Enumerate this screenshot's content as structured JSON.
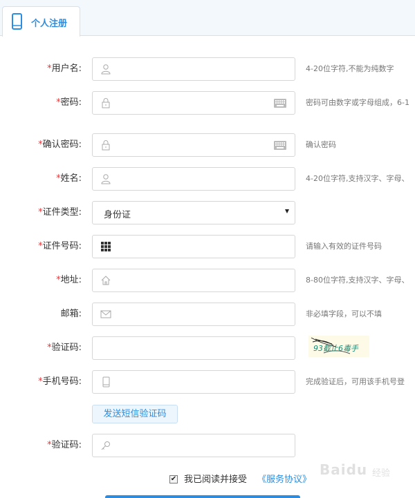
{
  "tab": {
    "label": "个人注册"
  },
  "required_mark": "*",
  "fields": {
    "username": {
      "label": "用户名:",
      "hint": "4-20位字符,不能为纯数字",
      "value": ""
    },
    "password": {
      "label": "密码:",
      "hint": "密码可由数字或字母组成，6-1",
      "value": ""
    },
    "confirm_password": {
      "label": "确认密码:",
      "hint": "确认密码",
      "value": ""
    },
    "name": {
      "label": "姓名:",
      "hint": "4-20位字符,支持汉字、字母、",
      "value": ""
    },
    "id_type": {
      "label": "证件类型:",
      "selected": "身份证"
    },
    "id_number": {
      "label": "证件号码:",
      "hint": "请输入有效的证件号码",
      "value": ""
    },
    "address": {
      "label": "地址:",
      "hint": "8-80位字符,支持汉字、字母、",
      "value": ""
    },
    "email": {
      "label": "邮箱:",
      "hint": "非必填字段，可以不填",
      "value": ""
    },
    "captcha": {
      "label": "验证码:",
      "image_text": "93截止6毒手",
      "value": ""
    },
    "phone": {
      "label": "手机号码:",
      "hint": "完成验证后，可用该手机号登",
      "value": ""
    },
    "sms_code": {
      "label": "验证码:",
      "value": ""
    }
  },
  "sms_button": "发送短信验证码",
  "agreement": {
    "checked": true,
    "checkmark": "✔",
    "text": "我已阅读并接受",
    "link": "《服务协议》"
  },
  "watermark": {
    "brand": "Baidu",
    "sub": "经验"
  },
  "colors": {
    "accent": "#2c8de0",
    "required": "#e4393c"
  }
}
